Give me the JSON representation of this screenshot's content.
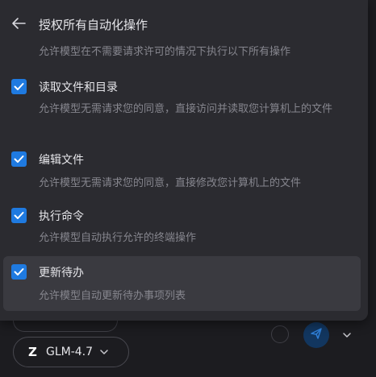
{
  "header": {
    "title": "授权所有自动化操作",
    "description": "允许模型在不需要请求许可的情况下执行以下所有操作"
  },
  "permissions": [
    {
      "label": "读取文件和目录",
      "description": "允许模型无需请求您的同意，直接访问并读取您计算机上的文件",
      "checked": true
    },
    {
      "label": "编辑文件",
      "description": "允许模型无需请求您的同意，直接修改您计算机上的文件",
      "checked": true
    },
    {
      "label": "执行命令",
      "description": "允许模型自动执行允许的终端操作",
      "checked": true
    },
    {
      "label": "更新待办",
      "description": "允许模型自动更新待办事项列表",
      "checked": true
    }
  ],
  "composer": {
    "model_label": "GLM-4.7",
    "model_logo": "Z"
  },
  "colors": {
    "accent": "#1f7ae0",
    "panel": "#2b2b30",
    "highlight": "#3a3a40"
  },
  "icons": {
    "back": "arrow-left-icon",
    "check": "check-icon",
    "send": "send-icon",
    "more": "chevron-down-icon",
    "model_dropdown": "chevron-down-icon"
  }
}
